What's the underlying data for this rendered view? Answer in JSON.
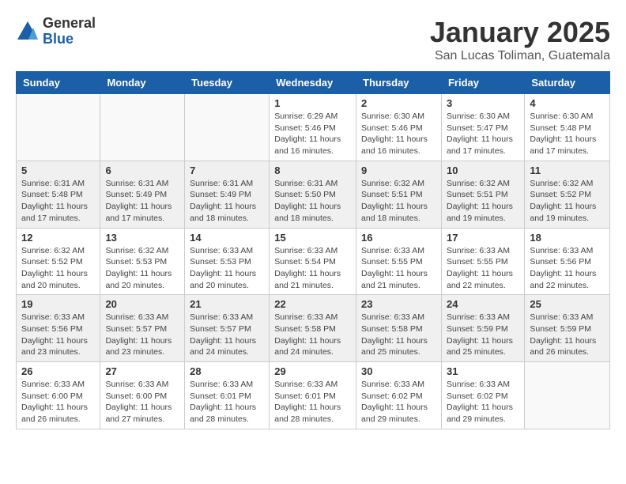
{
  "logo": {
    "general": "General",
    "blue": "Blue"
  },
  "header": {
    "month": "January 2025",
    "location": "San Lucas Toliman, Guatemala"
  },
  "weekdays": [
    "Sunday",
    "Monday",
    "Tuesday",
    "Wednesday",
    "Thursday",
    "Friday",
    "Saturday"
  ],
  "weeks": [
    [
      {
        "day": "",
        "info": ""
      },
      {
        "day": "",
        "info": ""
      },
      {
        "day": "",
        "info": ""
      },
      {
        "day": "1",
        "info": "Sunrise: 6:29 AM\nSunset: 5:46 PM\nDaylight: 11 hours\nand 16 minutes."
      },
      {
        "day": "2",
        "info": "Sunrise: 6:30 AM\nSunset: 5:46 PM\nDaylight: 11 hours\nand 16 minutes."
      },
      {
        "day": "3",
        "info": "Sunrise: 6:30 AM\nSunset: 5:47 PM\nDaylight: 11 hours\nand 17 minutes."
      },
      {
        "day": "4",
        "info": "Sunrise: 6:30 AM\nSunset: 5:48 PM\nDaylight: 11 hours\nand 17 minutes."
      }
    ],
    [
      {
        "day": "5",
        "info": "Sunrise: 6:31 AM\nSunset: 5:48 PM\nDaylight: 11 hours\nand 17 minutes."
      },
      {
        "day": "6",
        "info": "Sunrise: 6:31 AM\nSunset: 5:49 PM\nDaylight: 11 hours\nand 17 minutes."
      },
      {
        "day": "7",
        "info": "Sunrise: 6:31 AM\nSunset: 5:49 PM\nDaylight: 11 hours\nand 18 minutes."
      },
      {
        "day": "8",
        "info": "Sunrise: 6:31 AM\nSunset: 5:50 PM\nDaylight: 11 hours\nand 18 minutes."
      },
      {
        "day": "9",
        "info": "Sunrise: 6:32 AM\nSunset: 5:51 PM\nDaylight: 11 hours\nand 18 minutes."
      },
      {
        "day": "10",
        "info": "Sunrise: 6:32 AM\nSunset: 5:51 PM\nDaylight: 11 hours\nand 19 minutes."
      },
      {
        "day": "11",
        "info": "Sunrise: 6:32 AM\nSunset: 5:52 PM\nDaylight: 11 hours\nand 19 minutes."
      }
    ],
    [
      {
        "day": "12",
        "info": "Sunrise: 6:32 AM\nSunset: 5:52 PM\nDaylight: 11 hours\nand 20 minutes."
      },
      {
        "day": "13",
        "info": "Sunrise: 6:32 AM\nSunset: 5:53 PM\nDaylight: 11 hours\nand 20 minutes."
      },
      {
        "day": "14",
        "info": "Sunrise: 6:33 AM\nSunset: 5:53 PM\nDaylight: 11 hours\nand 20 minutes."
      },
      {
        "day": "15",
        "info": "Sunrise: 6:33 AM\nSunset: 5:54 PM\nDaylight: 11 hours\nand 21 minutes."
      },
      {
        "day": "16",
        "info": "Sunrise: 6:33 AM\nSunset: 5:55 PM\nDaylight: 11 hours\nand 21 minutes."
      },
      {
        "day": "17",
        "info": "Sunrise: 6:33 AM\nSunset: 5:55 PM\nDaylight: 11 hours\nand 22 minutes."
      },
      {
        "day": "18",
        "info": "Sunrise: 6:33 AM\nSunset: 5:56 PM\nDaylight: 11 hours\nand 22 minutes."
      }
    ],
    [
      {
        "day": "19",
        "info": "Sunrise: 6:33 AM\nSunset: 5:56 PM\nDaylight: 11 hours\nand 23 minutes."
      },
      {
        "day": "20",
        "info": "Sunrise: 6:33 AM\nSunset: 5:57 PM\nDaylight: 11 hours\nand 23 minutes."
      },
      {
        "day": "21",
        "info": "Sunrise: 6:33 AM\nSunset: 5:57 PM\nDaylight: 11 hours\nand 24 minutes."
      },
      {
        "day": "22",
        "info": "Sunrise: 6:33 AM\nSunset: 5:58 PM\nDaylight: 11 hours\nand 24 minutes."
      },
      {
        "day": "23",
        "info": "Sunrise: 6:33 AM\nSunset: 5:58 PM\nDaylight: 11 hours\nand 25 minutes."
      },
      {
        "day": "24",
        "info": "Sunrise: 6:33 AM\nSunset: 5:59 PM\nDaylight: 11 hours\nand 25 minutes."
      },
      {
        "day": "25",
        "info": "Sunrise: 6:33 AM\nSunset: 5:59 PM\nDaylight: 11 hours\nand 26 minutes."
      }
    ],
    [
      {
        "day": "26",
        "info": "Sunrise: 6:33 AM\nSunset: 6:00 PM\nDaylight: 11 hours\nand 26 minutes."
      },
      {
        "day": "27",
        "info": "Sunrise: 6:33 AM\nSunset: 6:00 PM\nDaylight: 11 hours\nand 27 minutes."
      },
      {
        "day": "28",
        "info": "Sunrise: 6:33 AM\nSunset: 6:01 PM\nDaylight: 11 hours\nand 28 minutes."
      },
      {
        "day": "29",
        "info": "Sunrise: 6:33 AM\nSunset: 6:01 PM\nDaylight: 11 hours\nand 28 minutes."
      },
      {
        "day": "30",
        "info": "Sunrise: 6:33 AM\nSunset: 6:02 PM\nDaylight: 11 hours\nand 29 minutes."
      },
      {
        "day": "31",
        "info": "Sunrise: 6:33 AM\nSunset: 6:02 PM\nDaylight: 11 hours\nand 29 minutes."
      },
      {
        "day": "",
        "info": ""
      }
    ]
  ]
}
